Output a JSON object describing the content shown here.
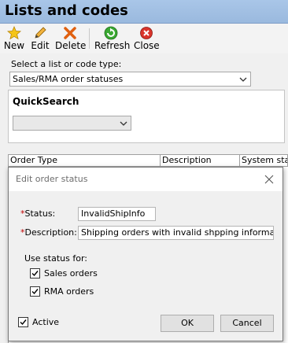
{
  "window": {
    "title": "Lists and codes"
  },
  "toolbar": {
    "new_label": "New",
    "edit_label": "Edit",
    "delete_label": "Delete",
    "refresh_label": "Refresh",
    "close_label": "Close"
  },
  "selector": {
    "label": "Select a list or code type:",
    "value": "Sales/RMA order statuses"
  },
  "quicksearch": {
    "title": "QuickSearch",
    "value": ""
  },
  "grid": {
    "columns": [
      "Order Type",
      "Description",
      "System status"
    ]
  },
  "dialog": {
    "title": "Edit order status",
    "status_label": "Status:",
    "status_value": "InvalidShipInfo",
    "description_label": "Description:",
    "description_value": "Shipping orders with invalid shpping information",
    "use_status_label": "Use status for:",
    "sales_orders_label": "Sales orders",
    "sales_orders_checked": true,
    "rma_orders_label": "RMA orders",
    "rma_orders_checked": true,
    "active_label": "Active",
    "active_checked": true,
    "ok_label": "OK",
    "cancel_label": "Cancel",
    "required_marker": "*"
  },
  "icons": {
    "new": "star-icon",
    "edit": "pencil-icon",
    "delete": "red-x-icon",
    "refresh": "green-refresh-icon",
    "close": "red-circle-x-icon"
  },
  "colors": {
    "titlebar": "#a9c6e8",
    "required": "#c00000"
  }
}
